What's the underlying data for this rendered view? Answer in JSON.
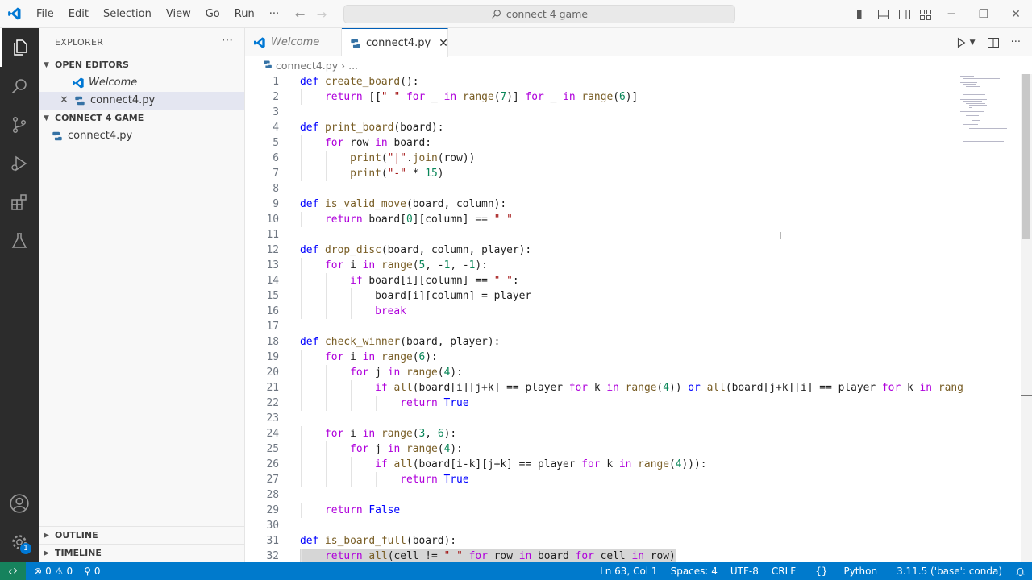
{
  "window": {
    "search_text": "connect 4 game"
  },
  "menu": [
    "File",
    "Edit",
    "Selection",
    "View",
    "Go",
    "Run",
    "···"
  ],
  "sidebar": {
    "title": "EXPLORER",
    "open_editors": {
      "label": "OPEN EDITORS",
      "items": [
        {
          "label": "Welcome"
        },
        {
          "label": "connect4.py"
        }
      ]
    },
    "folder": {
      "label": "CONNECT 4 GAME",
      "items": [
        {
          "label": "connect4.py"
        }
      ]
    },
    "outline": "OUTLINE",
    "timeline": "TIMELINE"
  },
  "tabs": [
    {
      "label": "Welcome"
    },
    {
      "label": "connect4.py"
    }
  ],
  "breadcrumb": {
    "file": "connect4.py",
    "sep": "›",
    "rest": "..."
  },
  "editor": {
    "lines": [
      [
        [
          "kw",
          "def "
        ],
        [
          "fn",
          "create_board"
        ],
        [
          "",
          "():"
        ]
      ],
      [
        [
          "",
          "    "
        ],
        [
          "ctl",
          "return"
        ],
        [
          "",
          " [["
        ],
        [
          "st",
          "\" \""
        ],
        [
          "",
          " "
        ],
        [
          "ctl",
          "for"
        ],
        [
          "",
          " _ "
        ],
        [
          "ctl",
          "in"
        ],
        [
          "",
          " "
        ],
        [
          "fn",
          "range"
        ],
        [
          "",
          "("
        ],
        [
          "nm",
          "7"
        ],
        [
          "",
          ")] "
        ],
        [
          "ctl",
          "for"
        ],
        [
          "",
          " _ "
        ],
        [
          "ctl",
          "in"
        ],
        [
          "",
          " "
        ],
        [
          "fn",
          "range"
        ],
        [
          "",
          "("
        ],
        [
          "nm",
          "6"
        ],
        [
          "",
          ")]"
        ]
      ],
      [],
      [
        [
          "kw",
          "def "
        ],
        [
          "fn",
          "print_board"
        ],
        [
          "",
          "(board):"
        ]
      ],
      [
        [
          "",
          "    "
        ],
        [
          "ctl",
          "for"
        ],
        [
          "",
          " row "
        ],
        [
          "ctl",
          "in"
        ],
        [
          "",
          " board:"
        ]
      ],
      [
        [
          "",
          "        "
        ],
        [
          "fn",
          "print"
        ],
        [
          "",
          "("
        ],
        [
          "st",
          "\"|\""
        ],
        [
          "",
          "."
        ],
        [
          "fn",
          "join"
        ],
        [
          "",
          "(row))"
        ]
      ],
      [
        [
          "",
          "        "
        ],
        [
          "fn",
          "print"
        ],
        [
          "",
          "("
        ],
        [
          "st",
          "\"-\""
        ],
        [
          "",
          " * "
        ],
        [
          "nm",
          "15"
        ],
        [
          "",
          ")"
        ]
      ],
      [],
      [
        [
          "kw",
          "def "
        ],
        [
          "fn",
          "is_valid_move"
        ],
        [
          "",
          "(board, column):"
        ]
      ],
      [
        [
          "",
          "    "
        ],
        [
          "ctl",
          "return"
        ],
        [
          "",
          " board["
        ],
        [
          "nm",
          "0"
        ],
        [
          "",
          "][column] == "
        ],
        [
          "st",
          "\" \""
        ]
      ],
      [],
      [
        [
          "kw",
          "def "
        ],
        [
          "fn",
          "drop_disc"
        ],
        [
          "",
          "(board, column, player):"
        ]
      ],
      [
        [
          "",
          "    "
        ],
        [
          "ctl",
          "for"
        ],
        [
          "",
          " i "
        ],
        [
          "ctl",
          "in"
        ],
        [
          "",
          " "
        ],
        [
          "fn",
          "range"
        ],
        [
          "",
          "("
        ],
        [
          "nm",
          "5"
        ],
        [
          "",
          ", -"
        ],
        [
          "nm",
          "1"
        ],
        [
          "",
          ", -"
        ],
        [
          "nm",
          "1"
        ],
        [
          "",
          "):"
        ]
      ],
      [
        [
          "",
          "        "
        ],
        [
          "ctl",
          "if"
        ],
        [
          "",
          " board[i][column] == "
        ],
        [
          "st",
          "\" \""
        ],
        [
          "",
          ":"
        ]
      ],
      [
        [
          "",
          "            board[i][column] = player"
        ]
      ],
      [
        [
          "",
          "            "
        ],
        [
          "ctl",
          "break"
        ]
      ],
      [],
      [
        [
          "kw",
          "def "
        ],
        [
          "fn",
          "check_winner"
        ],
        [
          "",
          "(board, player):"
        ]
      ],
      [
        [
          "",
          "    "
        ],
        [
          "ctl",
          "for"
        ],
        [
          "",
          " i "
        ],
        [
          "ctl",
          "in"
        ],
        [
          "",
          " "
        ],
        [
          "fn",
          "range"
        ],
        [
          "",
          "("
        ],
        [
          "nm",
          "6"
        ],
        [
          "",
          "):"
        ]
      ],
      [
        [
          "",
          "        "
        ],
        [
          "ctl",
          "for"
        ],
        [
          "",
          " j "
        ],
        [
          "ctl",
          "in"
        ],
        [
          "",
          " "
        ],
        [
          "fn",
          "range"
        ],
        [
          "",
          "("
        ],
        [
          "nm",
          "4"
        ],
        [
          "",
          "):"
        ]
      ],
      [
        [
          "",
          "            "
        ],
        [
          "ctl",
          "if"
        ],
        [
          "",
          " "
        ],
        [
          "fn",
          "all"
        ],
        [
          "",
          "(board[i][j+k] == player "
        ],
        [
          "ctl",
          "for"
        ],
        [
          "",
          " k "
        ],
        [
          "ctl",
          "in"
        ],
        [
          "",
          " "
        ],
        [
          "fn",
          "range"
        ],
        [
          "",
          "("
        ],
        [
          "nm",
          "4"
        ],
        [
          "",
          ")) "
        ],
        [
          "kw",
          "or"
        ],
        [
          "",
          " "
        ],
        [
          "fn",
          "all"
        ],
        [
          "",
          "(board[j+k][i] == player "
        ],
        [
          "ctl",
          "for"
        ],
        [
          "",
          " k "
        ],
        [
          "ctl",
          "in"
        ],
        [
          "",
          " "
        ],
        [
          "fn",
          "rang"
        ]
      ],
      [
        [
          "",
          "                "
        ],
        [
          "ctl",
          "return"
        ],
        [
          "",
          " "
        ],
        [
          "kw",
          "True"
        ]
      ],
      [],
      [
        [
          "",
          "    "
        ],
        [
          "ctl",
          "for"
        ],
        [
          "",
          " i "
        ],
        [
          "ctl",
          "in"
        ],
        [
          "",
          " "
        ],
        [
          "fn",
          "range"
        ],
        [
          "",
          "("
        ],
        [
          "nm",
          "3"
        ],
        [
          "",
          ", "
        ],
        [
          "nm",
          "6"
        ],
        [
          "",
          "):"
        ]
      ],
      [
        [
          "",
          "        "
        ],
        [
          "ctl",
          "for"
        ],
        [
          "",
          " j "
        ],
        [
          "ctl",
          "in"
        ],
        [
          "",
          " "
        ],
        [
          "fn",
          "range"
        ],
        [
          "",
          "("
        ],
        [
          "nm",
          "4"
        ],
        [
          "",
          "):"
        ]
      ],
      [
        [
          "",
          "            "
        ],
        [
          "ctl",
          "if"
        ],
        [
          "",
          " "
        ],
        [
          "fn",
          "all"
        ],
        [
          "",
          "(board[i-k][j+k] == player "
        ],
        [
          "ctl",
          "for"
        ],
        [
          "",
          " k "
        ],
        [
          "ctl",
          "in"
        ],
        [
          "",
          " "
        ],
        [
          "fn",
          "range"
        ],
        [
          "",
          "("
        ],
        [
          "nm",
          "4"
        ],
        [
          "",
          "))):"
        ]
      ],
      [
        [
          "",
          "                "
        ],
        [
          "ctl",
          "return"
        ],
        [
          "",
          " "
        ],
        [
          "kw",
          "True"
        ]
      ],
      [],
      [
        [
          "",
          "    "
        ],
        [
          "ctl",
          "return"
        ],
        [
          "",
          " "
        ],
        [
          "kw",
          "False"
        ]
      ],
      [],
      [
        [
          "kw",
          "def "
        ],
        [
          "fn",
          "is_board_full"
        ],
        [
          "",
          "(board):"
        ]
      ],
      [
        [
          "",
          "    "
        ],
        [
          "ctl",
          "return"
        ],
        [
          "",
          " "
        ],
        [
          "fn",
          "all"
        ],
        [
          "",
          "(cell != "
        ],
        [
          "st",
          "\" \""
        ],
        [
          "",
          " "
        ],
        [
          "ctl",
          "for"
        ],
        [
          "",
          " row "
        ],
        [
          "ctl",
          "in"
        ],
        [
          "",
          " board "
        ],
        [
          "ctl",
          "for"
        ],
        [
          "",
          " cell "
        ],
        [
          "ctl",
          "in"
        ],
        [
          "",
          " row)"
        ]
      ]
    ],
    "highlight_line": 32
  },
  "statusbar": {
    "errors": "0",
    "warnings": "0",
    "ports": "0",
    "position": "Ln 63, Col 1",
    "spaces": "Spaces: 4",
    "encoding": "UTF-8",
    "eol": "CRLF",
    "language": "Python",
    "interpreter": "3.11.5 ('base': conda)"
  },
  "colors": {
    "accent": "#007acc",
    "activity_bg": "#2c2c2c",
    "remote": "#16825d"
  }
}
